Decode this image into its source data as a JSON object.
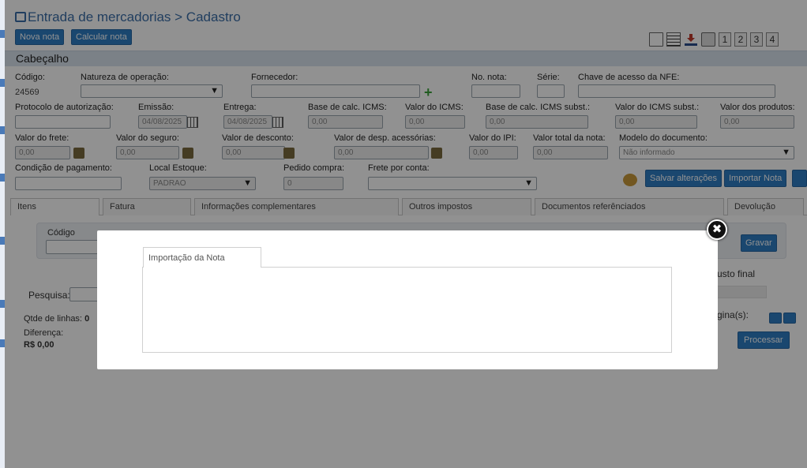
{
  "page": {
    "title": "Entrada de mercadorias > Cadastro"
  },
  "toolbar": {
    "new_label": "Nova nota",
    "calc_label": "Calcular nota",
    "icons": [
      "document-icon",
      "list-icon",
      "download-icon",
      "print-icon"
    ],
    "pages": [
      "1",
      "2",
      "3",
      "4"
    ]
  },
  "header": {
    "section_title": "Cabeçalho",
    "codigo_label": "Código:",
    "codigo_value": "24569",
    "natureza_label": "Natureza de operação:",
    "fornecedor_label": "Fornecedor:",
    "no_nota_label": "No. nota:",
    "serie_label": "Série:",
    "chave_label": "Chave de acesso da NFE:",
    "protocolo_label": "Protocolo de autorização:",
    "emissao_label": "Emissão:",
    "emissao_value": "04/08/2025",
    "entrega_label": "Entrega:",
    "entrega_value": "04/08/2025",
    "base_icms_label": "Base de calc. ICMS:",
    "base_icms_value": "0,00",
    "valor_icms_label": "Valor do ICMS:",
    "valor_icms_value": "0,00",
    "base_icms_subst_label": "Base de calc. ICMS subst.:",
    "base_icms_subst_value": "0,00",
    "valor_icms_subst_label": "Valor do ICMS subst.:",
    "valor_icms_subst_value": "0,00",
    "valor_produtos_label": "Valor dos produtos:",
    "valor_produtos_value": "0,00",
    "frete_label": "Valor do frete:",
    "frete_value": "0,00",
    "seguro_label": "Valor do seguro:",
    "seguro_value": "0,00",
    "desconto_label": "Valor de desconto:",
    "desconto_value": "0,00",
    "despesas_label": "Valor de desp. acessórias:",
    "despesas_value": "0,00",
    "ipi_label": "Valor do IPI:",
    "ipi_value": "0,00",
    "total_label": "Valor total da nota:",
    "total_value": "0,00",
    "modelo_label": "Modelo do documento:",
    "modelo_value": "Não informado",
    "condicao_label": "Condição de pagamento:",
    "local_label": "Local Estoque:",
    "local_value": "PADRAO",
    "pedido_label": "Pedido compra:",
    "pedido_value": "0",
    "frete_conta_label": "Frete por conta:",
    "salvar_label": "Salvar alterações",
    "importar_label": "Importar Nota"
  },
  "tabs": [
    {
      "label": "Itens"
    },
    {
      "label": "Fatura"
    },
    {
      "label": "Informações complementares"
    },
    {
      "label": "Outros impostos"
    },
    {
      "label": "Documentos referênciados"
    },
    {
      "label": "Devolução"
    }
  ],
  "items": {
    "codigo_label": "Código",
    "gravar_label": "Gravar",
    "custo_final_label": "usto final",
    "pesquisa_label": "Pesquisa:",
    "qtde_label": "Qtde de linhas:",
    "qtde_value": "0",
    "diferenca_label": "Diferença:",
    "diferenca_value": "R$ 0,00",
    "paginas_label": "gina(s):",
    "processar_label": "Processar"
  },
  "modal": {
    "tab_label": "Importação da Nota",
    "close_icon": "close-icon"
  }
}
